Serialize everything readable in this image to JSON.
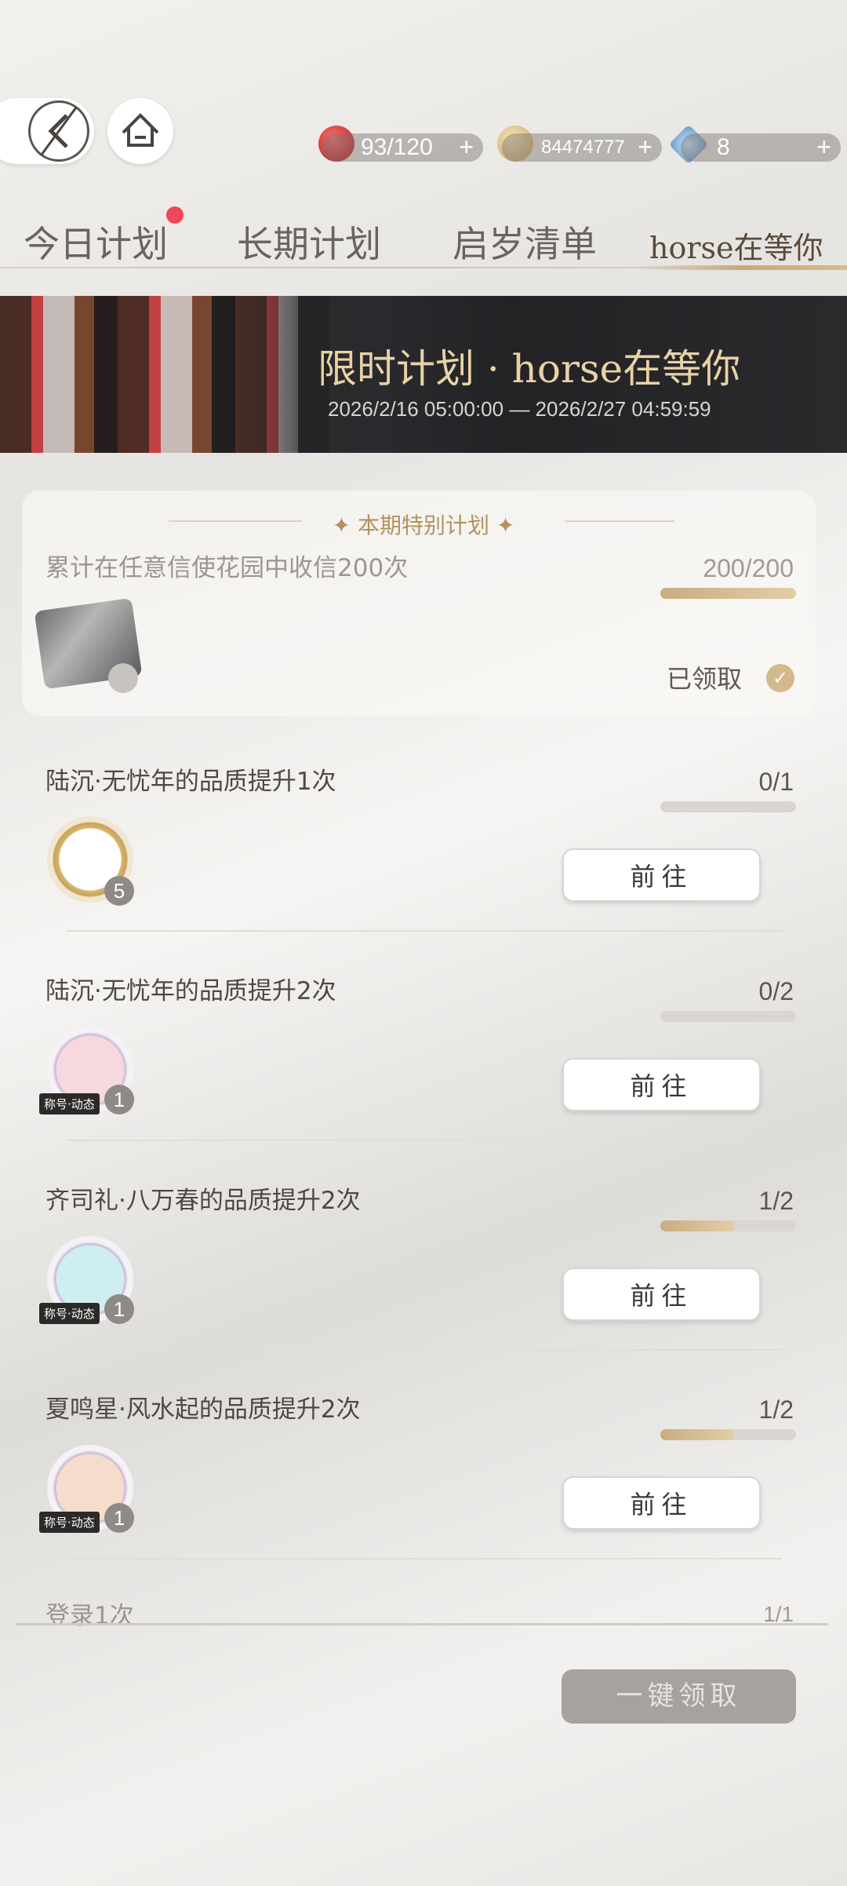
{
  "resources": {
    "stamina": "93/120",
    "coins": "84474777",
    "gems": "8",
    "plus": "+"
  },
  "tabs": [
    {
      "label": "今日计划"
    },
    {
      "label": "长期计划"
    },
    {
      "label": "启岁清单"
    },
    {
      "label": "horse在等你"
    }
  ],
  "banner": {
    "title": "限时计划 · horse在等你",
    "date": "2026/2/16 05:00:00 — 2026/2/27 04:59:59"
  },
  "special": {
    "header": "✦  本期特别计划  ✦",
    "title": "累计在任意信使花园中收信200次",
    "count": "200/200",
    "progress": 1.0,
    "status": "已领取"
  },
  "tasks": [
    {
      "title": "陆沉·无忧年的品质提升1次",
      "count": "0/1",
      "progress": 0.0,
      "button": "前往",
      "reward_count": "5",
      "reward_tag": ""
    },
    {
      "title": "陆沉·无忧年的品质提升2次",
      "count": "0/2",
      "progress": 0.0,
      "button": "前往",
      "reward_count": "1",
      "reward_tag": "称号·动态"
    },
    {
      "title": "齐司礼·八万春的品质提升2次",
      "count": "1/2",
      "progress": 0.5,
      "button": "前往",
      "reward_count": "1",
      "reward_tag": "称号·动态"
    },
    {
      "title": "夏鸣星·风水起的品质提升2次",
      "count": "1/2",
      "progress": 0.5,
      "button": "前往",
      "reward_count": "1",
      "reward_tag": "称号·动态"
    },
    {
      "title": "登录1次",
      "count": "1/1"
    }
  ],
  "claim_all": "一键领取"
}
